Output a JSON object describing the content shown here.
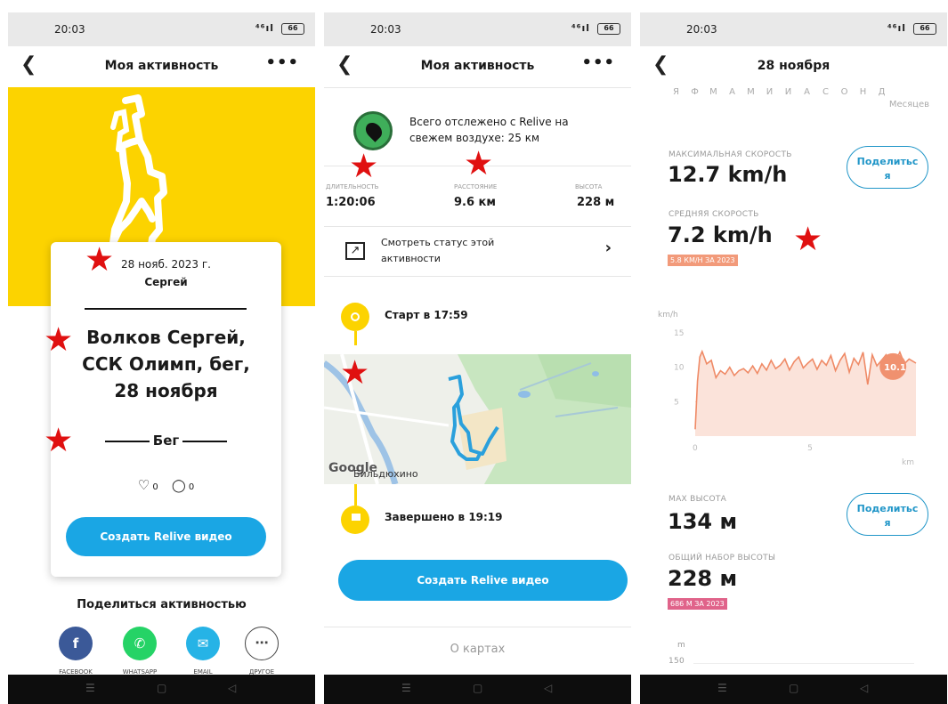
{
  "status": {
    "time": "20:03",
    "signal": "⁴⁶ıl",
    "battery": "66"
  },
  "s1": {
    "title": "Моя активность",
    "date": "28 нояб. 2023 г.",
    "user": "Сергей",
    "activity_title_1": "Волков Сергей,",
    "activity_title_2": "ССК Олимп, бег,",
    "activity_title_3": "28 ноября",
    "sport": "Бег",
    "likes": "0",
    "comments": "0",
    "create_btn": "Создать Relive видео",
    "share_title": "Поделиться активностью",
    "share": [
      {
        "label": "FACEBOOK",
        "color": "#3b5998",
        "icon": "facebook-icon"
      },
      {
        "label": "WHATSAPP",
        "color": "#25d366",
        "icon": "whatsapp-icon"
      },
      {
        "label": "EMAIL",
        "color": "#26b3e6",
        "icon": "email-icon"
      },
      {
        "label": "ДРУГОЕ",
        "color": "#ffffff",
        "icon": "more-icon"
      }
    ]
  },
  "s2": {
    "title": "Моя активность",
    "tracked_1": "Всего отслежено с Relive на",
    "tracked_2": "свежем воздухе: 25 км",
    "stats": [
      {
        "label": "ДЛИТЕЛЬНОСТЬ",
        "value": "1:20:06"
      },
      {
        "label": "РАССТОЯНИЕ",
        "value": "9.6 км"
      },
      {
        "label": "ВЫСОТА",
        "value": "228 м"
      }
    ],
    "status_1": "Смотреть статус этой",
    "status_2": "активности",
    "start": "Старт в 17:59",
    "finish": "Завершено в 19:19",
    "map_place": "Бильдюхино",
    "map_brand": "Google",
    "create_btn": "Создать Relive видео",
    "about_maps": "О картах"
  },
  "s3": {
    "title": "28 ноября",
    "months": [
      "Я",
      "Ф",
      "М",
      "А",
      "М",
      "И",
      "И",
      "А",
      "С",
      "О",
      "Н",
      "Д"
    ],
    "months_label": "Месяцев",
    "max_speed_label": "МАКСИМАЛЬНАЯ СКОРОСТЬ",
    "max_speed": "12.7 km/h",
    "share_label_1": "Поделитьс",
    "share_label_2": "я",
    "avg_speed_label": "СРЕДНЯЯ СКОРОСТЬ",
    "avg_speed": "7.2 km/h",
    "avg_badge": "5.8 КМ/Н ЗА 2023",
    "max_alt_label": "MAX ВЫСОТА",
    "max_alt": "134 м",
    "gain_label": "ОБЩИЙ НАБОР ВЫСОТЫ",
    "gain": "228 м",
    "gain_badge": "686 М ЗА 2023",
    "alt_unit": "m",
    "alt_tick": "150"
  },
  "chart_data": {
    "type": "line",
    "title": "",
    "xlabel": "km",
    "ylabel": "km/h",
    "xlim": [
      0,
      9.6
    ],
    "ylim": [
      0,
      15
    ],
    "x_ticks": [
      0,
      5
    ],
    "y_ticks": [
      5,
      10,
      15
    ],
    "highlight": {
      "x": 8.6,
      "label": "10.1"
    },
    "x": [
      0,
      0.1,
      0.2,
      0.3,
      0.5,
      0.7,
      0.9,
      1.1,
      1.3,
      1.5,
      1.7,
      1.9,
      2.1,
      2.3,
      2.5,
      2.7,
      2.9,
      3.1,
      3.3,
      3.5,
      3.7,
      3.9,
      4.1,
      4.3,
      4.5,
      4.7,
      4.9,
      5.1,
      5.3,
      5.5,
      5.7,
      5.9,
      6.1,
      6.3,
      6.5,
      6.7,
      6.9,
      7.1,
      7.3,
      7.5,
      7.7,
      7.9,
      8.1,
      8.3,
      8.5,
      8.7,
      8.9,
      9.1,
      9.3,
      9.6
    ],
    "values": [
      1,
      8,
      11.5,
      12.3,
      10.5,
      11,
      8.5,
      9.5,
      9,
      10,
      8.8,
      9.5,
      9.8,
      9.2,
      10.2,
      9.1,
      10.5,
      9.6,
      11,
      9.8,
      10.3,
      11.2,
      9.6,
      10.8,
      11.5,
      9.9,
      10.6,
      11.2,
      9.7,
      11,
      10.3,
      11.7,
      9.5,
      11,
      12,
      9.3,
      11.3,
      10.4,
      12.2,
      7.5,
      11.8,
      10.2,
      11,
      11.8,
      10.1,
      10.8,
      12.2,
      10.5,
      11.2,
      10.6
    ]
  }
}
